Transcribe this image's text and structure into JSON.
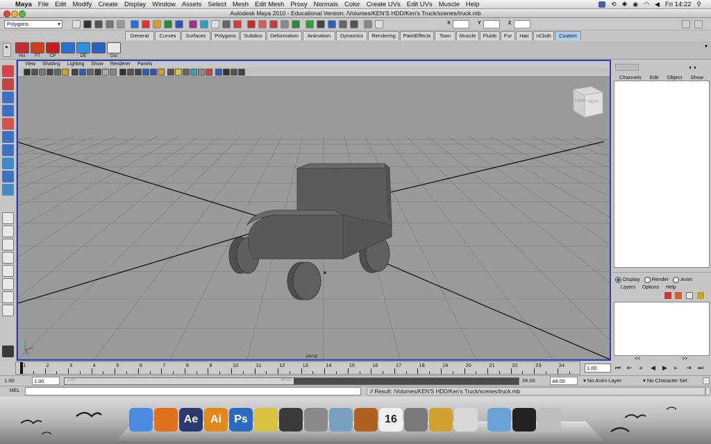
{
  "menubar": {
    "app": "Maya",
    "items": [
      "File",
      "Edit",
      "Modify",
      "Create",
      "Display",
      "Window",
      "Assets",
      "Select",
      "Mesh",
      "Edit Mesh",
      "Proxy",
      "Normals",
      "Color",
      "Create UVs",
      "Edit UVs",
      "Muscle",
      "Help"
    ],
    "clock": "Fri 14:22"
  },
  "window": {
    "title": "Autodesk Maya 2010 - Educational Version: /Volumes/KEN'S HDD/Ken's Truck/scenes/truck.mb"
  },
  "statusline": {
    "mode": "Polygons",
    "x_label": "X",
    "y_label": "Y",
    "z_label": "Z"
  },
  "shelf_tabs": [
    {
      "label": "General"
    },
    {
      "label": "Curves"
    },
    {
      "label": "Surfaces"
    },
    {
      "label": "Polygons"
    },
    {
      "label": "Subdivs"
    },
    {
      "label": "Deformation"
    },
    {
      "label": "Animation"
    },
    {
      "label": "Dynamics"
    },
    {
      "label": "Rendering"
    },
    {
      "label": "PaintEffects"
    },
    {
      "label": "Toon"
    },
    {
      "label": "Muscle"
    },
    {
      "label": "Fluids"
    },
    {
      "label": "Fur"
    },
    {
      "label": "Hair"
    },
    {
      "label": "nCloth"
    },
    {
      "label": "Custom"
    }
  ],
  "active_tab": "Custom",
  "shelf_buttons": [
    {
      "label": "His",
      "color": "#c03030"
    },
    {
      "label": "FT",
      "color": "#d04020"
    },
    {
      "label": "CP",
      "color": "#c02020"
    },
    {
      "label": "",
      "color": "#2a6fd6"
    },
    {
      "label": "DE",
      "color": "#2f8fe0"
    },
    {
      "label": "",
      "color": "#2a60c0"
    },
    {
      "label": "Out",
      "color": "#e8e8e8"
    }
  ],
  "panel_menu": [
    "View",
    "Shading",
    "Lighting",
    "Show",
    "Renderer",
    "Panels"
  ],
  "viewport": {
    "camera": "persp",
    "viewcube_front": "FRONT",
    "viewcube_right": "RIGHT"
  },
  "channel_box": {
    "tabs": [
      "Channels",
      "Edit",
      "Object",
      "Show"
    ]
  },
  "layer_editor": {
    "modes": [
      "Display",
      "Render",
      "Anim"
    ],
    "selected_mode": "Display",
    "menu": [
      "Layers",
      "Options",
      "Help"
    ],
    "nav_left": "<<",
    "nav_right": ">>"
  },
  "time_slider": {
    "ticks": [
      "1",
      "2",
      "3",
      "4",
      "5",
      "6",
      "7",
      "8",
      "9",
      "10",
      "11",
      "12",
      "13",
      "14",
      "15",
      "16",
      "17",
      "18",
      "19",
      "20",
      "21",
      "22",
      "23",
      "24"
    ],
    "current_time": "1.00"
  },
  "range_slider": {
    "start_time": "1.00",
    "playback_start": "1.00",
    "range_start_label": "1.00",
    "range_end_label": "24.00",
    "playback_end": "24.00",
    "end_time": "48.00",
    "anim_layer": "No Anim Layer",
    "character_set": "No Character Set"
  },
  "command_line": {
    "label": "MEL",
    "result": "// Result: /Volumes/KEN'S HDD/Ken's Truck/scenes/truck.mb"
  },
  "dock": {
    "icons": [
      {
        "name": "finder-icon",
        "label": "",
        "color": "#4a8be0"
      },
      {
        "name": "firefox-icon",
        "label": "",
        "color": "#e0701c"
      },
      {
        "name": "after-effects-icon",
        "label": "Ae",
        "color": "#2a3a70"
      },
      {
        "name": "illustrator-icon",
        "label": "Ai",
        "color": "#e0881c"
      },
      {
        "name": "photoshop-icon",
        "label": "Ps",
        "color": "#2a6ac0"
      },
      {
        "name": "pencil-icon",
        "label": "",
        "color": "#d8c040"
      },
      {
        "name": "maya-icon",
        "label": "",
        "color": "#3a3a3a"
      },
      {
        "name": "camera-icon",
        "label": "",
        "color": "#8a8a8a"
      },
      {
        "name": "preview-icon",
        "label": "",
        "color": "#7aa0c0"
      },
      {
        "name": "guitar-icon",
        "label": "",
        "color": "#b06020"
      },
      {
        "name": "calendar-icon",
        "label": "16",
        "color": "#f0f0f0"
      },
      {
        "name": "system-prefs-icon",
        "label": "",
        "color": "#7a7a7a"
      },
      {
        "name": "keychain-icon",
        "label": "",
        "color": "#d0a030"
      },
      {
        "name": "stack-icon",
        "label": "",
        "color": "#d8d8d8"
      },
      {
        "name": "folder-icon",
        "label": "",
        "color": "#6aa0d8"
      },
      {
        "name": "terminal-icon",
        "label": "",
        "color": "#222222"
      },
      {
        "name": "trash-icon",
        "label": "",
        "color": "#bdbdbd"
      }
    ]
  },
  "colors": {
    "viewport_bg": "#9a9a9a",
    "viewport_border": "#2b3eb5",
    "truck": "#5d5d5d",
    "grid": "#7e7e7e"
  }
}
